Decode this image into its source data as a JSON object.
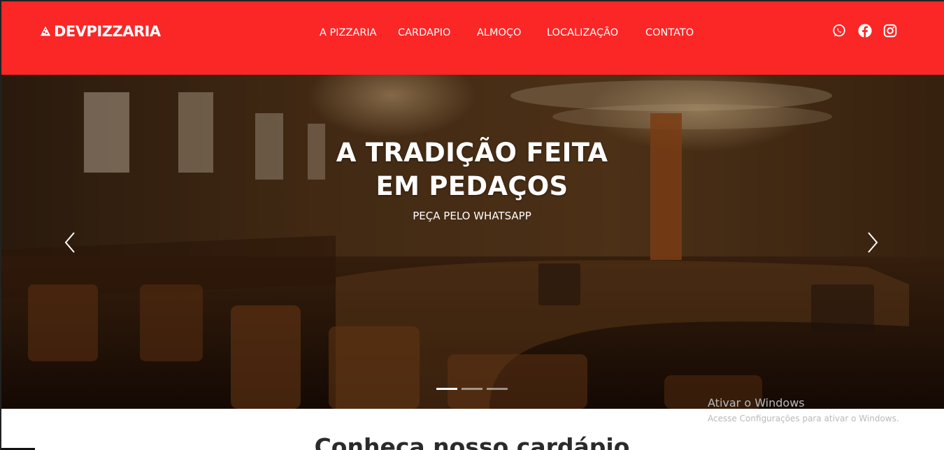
{
  "header": {
    "logo_text": "DEVPIZZARIA",
    "bg_color": "#fb2626",
    "nav": [
      {
        "label": "A PIZZARIA"
      },
      {
        "label": "CARDAPIO"
      },
      {
        "label": "ALMOÇO"
      },
      {
        "label": "LOCALIZAÇÃO"
      },
      {
        "label": "CONTATO"
      }
    ],
    "social_icons": [
      "whatsapp-icon",
      "facebook-icon",
      "instagram-icon"
    ]
  },
  "hero": {
    "title_line1": "A TRADIÇÃO FEITA",
    "title_line2": "EM PEDAÇOS",
    "subtitle": "PEÇA PELO WHATSAPP",
    "slides_count": 3,
    "active_slide": 1
  },
  "watermark": {
    "title": "Ativar o Windows",
    "subtitle": "Acesse Configurações para ativar o Windows."
  },
  "section": {
    "title": "Conheça nosso cardápio"
  }
}
